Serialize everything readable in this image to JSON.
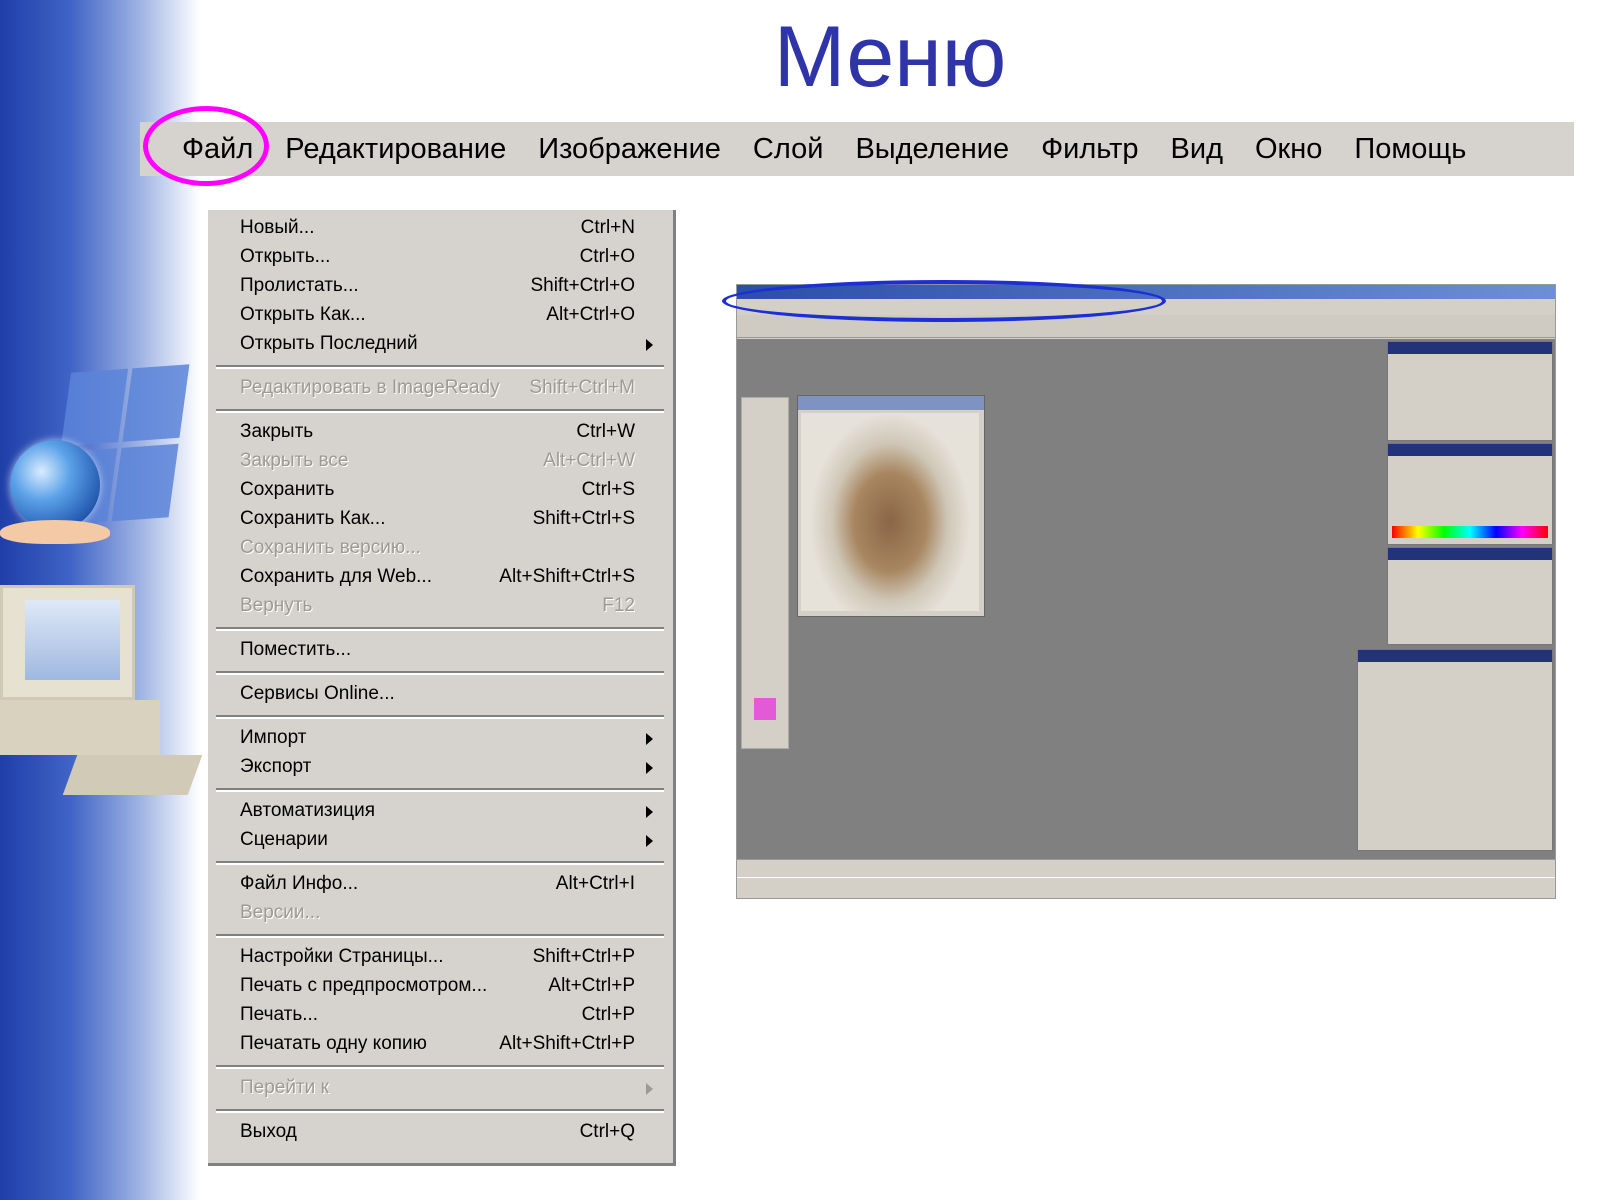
{
  "slide": {
    "title": "Меню",
    "highlight_color_menu": "#ff00ff",
    "highlight_color_screenshot": "#1a2fd4",
    "title_color": "#2f35a9"
  },
  "menubar": {
    "items": [
      "Файл",
      "Редактирование",
      "Изображение",
      "Слой",
      "Выделение",
      "Фильтр",
      "Вид",
      "Окно",
      "Помощь"
    ],
    "active": "Файл"
  },
  "file_menu": {
    "items": [
      {
        "label": "Новый...",
        "shortcut": "Ctrl+N",
        "enabled": true,
        "submenu": false
      },
      {
        "label": "Открыть...",
        "shortcut": "Ctrl+O",
        "enabled": true,
        "submenu": false
      },
      {
        "label": "Пролистать...",
        "shortcut": "Shift+Ctrl+O",
        "enabled": true,
        "submenu": false
      },
      {
        "label": "Открыть Как...",
        "shortcut": "Alt+Ctrl+O",
        "enabled": true,
        "submenu": false
      },
      {
        "label": "Открыть Последний",
        "shortcut": "",
        "enabled": true,
        "submenu": true
      },
      {
        "label": "Редактировать в ImageReady",
        "shortcut": "Shift+Ctrl+M",
        "enabled": false,
        "submenu": false
      },
      {
        "label": "Закрыть",
        "shortcut": "Ctrl+W",
        "enabled": true,
        "submenu": false
      },
      {
        "label": "Закрыть все",
        "shortcut": "Alt+Ctrl+W",
        "enabled": false,
        "submenu": false
      },
      {
        "label": "Сохранить",
        "shortcut": "Ctrl+S",
        "enabled": true,
        "submenu": false
      },
      {
        "label": "Сохранить Как...",
        "shortcut": "Shift+Ctrl+S",
        "enabled": true,
        "submenu": false
      },
      {
        "label": "Сохранить версию...",
        "shortcut": "",
        "enabled": false,
        "submenu": false
      },
      {
        "label": "Сохранить для Web...",
        "shortcut": "Alt+Shift+Ctrl+S",
        "enabled": true,
        "submenu": false
      },
      {
        "label": "Вернуть",
        "shortcut": "F12",
        "enabled": false,
        "submenu": false
      },
      {
        "label": "Поместить...",
        "shortcut": "",
        "enabled": true,
        "submenu": false
      },
      {
        "label": "Сервисы Online...",
        "shortcut": "",
        "enabled": true,
        "submenu": false
      },
      {
        "label": "Импорт",
        "shortcut": "",
        "enabled": true,
        "submenu": true
      },
      {
        "label": "Экспорт",
        "shortcut": "",
        "enabled": true,
        "submenu": true
      },
      {
        "label": "Автоматизиция",
        "shortcut": "",
        "enabled": true,
        "submenu": true
      },
      {
        "label": "Сценарии",
        "shortcut": "",
        "enabled": true,
        "submenu": true
      },
      {
        "label": "Файл Инфо...",
        "shortcut": "Alt+Ctrl+I",
        "enabled": true,
        "submenu": false
      },
      {
        "label": "Версии...",
        "shortcut": "",
        "enabled": false,
        "submenu": false
      },
      {
        "label": "Настройки Страницы...",
        "shortcut": "Shift+Ctrl+P",
        "enabled": true,
        "submenu": false
      },
      {
        "label": "Печать с предпросмотром...",
        "shortcut": "Alt+Ctrl+P",
        "enabled": true,
        "submenu": false
      },
      {
        "label": "Печать...",
        "shortcut": "Ctrl+P",
        "enabled": true,
        "submenu": false
      },
      {
        "label": "Печатать одну копию",
        "shortcut": "Alt+Shift+Ctrl+P",
        "enabled": true,
        "submenu": false
      },
      {
        "label": "Перейти к",
        "shortcut": "",
        "enabled": false,
        "submenu": true
      },
      {
        "label": "Выход",
        "shortcut": "Ctrl+Q",
        "enabled": true,
        "submenu": false
      }
    ]
  }
}
